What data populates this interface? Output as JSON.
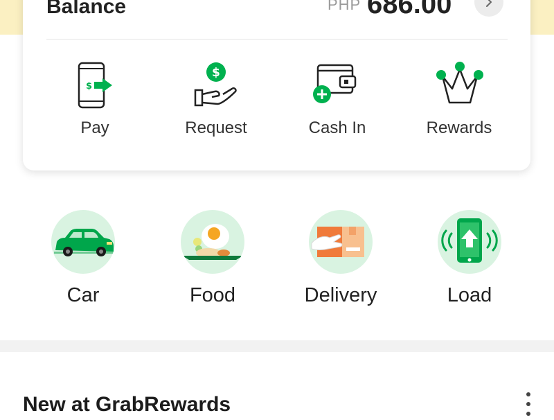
{
  "wallet": {
    "balance_label": "Balance",
    "currency": "PHP",
    "balance_amount": "686.00",
    "actions": [
      {
        "label": "Pay",
        "icon": "phone-pay-icon"
      },
      {
        "label": "Request",
        "icon": "hand-coin-icon"
      },
      {
        "label": "Cash In",
        "icon": "wallet-add-icon"
      },
      {
        "label": "Rewards",
        "icon": "crown-icon"
      }
    ]
  },
  "services": [
    {
      "label": "Car",
      "icon": "car-icon"
    },
    {
      "label": "Food",
      "icon": "food-plate-icon"
    },
    {
      "label": "Delivery",
      "icon": "delivery-box-icon"
    },
    {
      "label": "Load",
      "icon": "phone-load-icon"
    }
  ],
  "rewards_section": {
    "title": "New at GrabRewards"
  },
  "colors": {
    "accent_green": "#00b14f",
    "top_band": "#fbf0c2",
    "service_bg": "#d9f3e1"
  }
}
